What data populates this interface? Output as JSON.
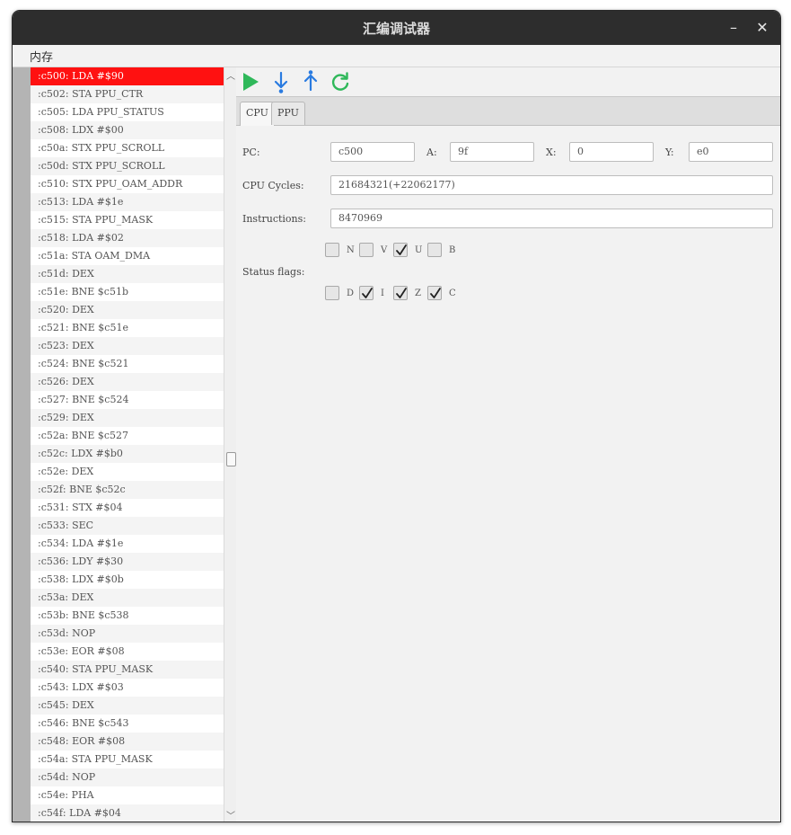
{
  "window": {
    "title": "汇编调试器",
    "minimize": "–",
    "close": "✕"
  },
  "menu": {
    "items": [
      "内存"
    ]
  },
  "code": {
    "selected_index": 0,
    "rows": [
      ":c500: LDA #$90",
      ":c502: STA PPU_CTR",
      ":c505: LDA PPU_STATUS",
      ":c508: LDX #$00",
      ":c50a: STX PPU_SCROLL",
      ":c50d: STX PPU_SCROLL",
      ":c510: STX PPU_OAM_ADDR",
      ":c513: LDA #$1e",
      ":c515: STA PPU_MASK",
      ":c518: LDA #$02",
      ":c51a: STA OAM_DMA",
      ":c51d: DEX",
      ":c51e: BNE $c51b",
      ":c520: DEX",
      ":c521: BNE $c51e",
      ":c523: DEX",
      ":c524: BNE $c521",
      ":c526: DEX",
      ":c527: BNE $c524",
      ":c529: DEX",
      ":c52a: BNE $c527",
      ":c52c: LDX #$b0",
      ":c52e: DEX",
      ":c52f: BNE $c52c",
      ":c531: STX #$04",
      ":c533: SEC",
      ":c534: LDA #$1e",
      ":c536: LDY #$30",
      ":c538: LDX #$0b",
      ":c53a: DEX",
      ":c53b: BNE $c538",
      ":c53d: NOP",
      ":c53e: EOR #$08",
      ":c540: STA PPU_MASK",
      ":c543: LDX #$03",
      ":c545: DEX",
      ":c546: BNE $c543",
      ":c548: EOR #$08",
      ":c54a: STA PPU_MASK",
      ":c54d: NOP",
      ":c54e: PHA",
      ":c54f: LDA #$04"
    ]
  },
  "toolbar": {
    "icons": [
      "run-icon",
      "step-into-icon",
      "step-out-icon",
      "restart-icon"
    ],
    "play_color": "#2fb85a",
    "step_color": "#2a7be0",
    "restart_color": "#2fb85a"
  },
  "tabs": [
    {
      "label": "CPU",
      "active": true
    },
    {
      "label": "PPU",
      "active": false
    }
  ],
  "cpu": {
    "pc_label": "PC:",
    "pc": "c500",
    "a_label": "A:",
    "a": "9f",
    "x_label": "X:",
    "x": "0",
    "y_label": "Y:",
    "y": "e0",
    "cycles_label": "CPU Cycles:",
    "cycles": "21684321(+22062177)",
    "instructions_label": "Instructions:",
    "instructions": "8470969",
    "status_label": "Status flags:",
    "flags": [
      {
        "name": "N",
        "checked": false
      },
      {
        "name": "V",
        "checked": false
      },
      {
        "name": "U",
        "checked": true
      },
      {
        "name": "B",
        "checked": false
      },
      {
        "name": "D",
        "checked": false
      },
      {
        "name": "I",
        "checked": true
      },
      {
        "name": "Z",
        "checked": true
      },
      {
        "name": "C",
        "checked": true
      }
    ]
  },
  "colors": {
    "selected_row": "#ff1111",
    "titlebar": "#2d2d2d"
  }
}
